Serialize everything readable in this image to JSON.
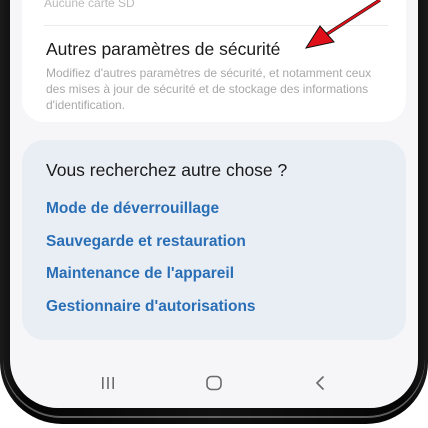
{
  "storage_row": {
    "value": "Aucune carte SD"
  },
  "security_item": {
    "title": "Autres paramètres de sécurité",
    "description": "Modifiez d'autres paramètres de sécurité, et notamment ceux des mises à jour de sécurité et de stockage des informations d'identification."
  },
  "looking_for": {
    "title": "Vous recherchez autre chose ?",
    "links": [
      {
        "label": "Mode de déverrouillage"
      },
      {
        "label": "Sauvegarde et restauration"
      },
      {
        "label": "Maintenance de l'appareil"
      },
      {
        "label": "Gestionnaire d'autorisations"
      }
    ]
  },
  "navigation_bar": {
    "buttons": [
      "recents-icon",
      "home-icon",
      "back-icon"
    ]
  },
  "colors": {
    "link": "#2a6fb6",
    "card_bottom_bg": "#e9eef5",
    "screen_bg": "#f6f6f8",
    "arrow": "#e0101a"
  }
}
